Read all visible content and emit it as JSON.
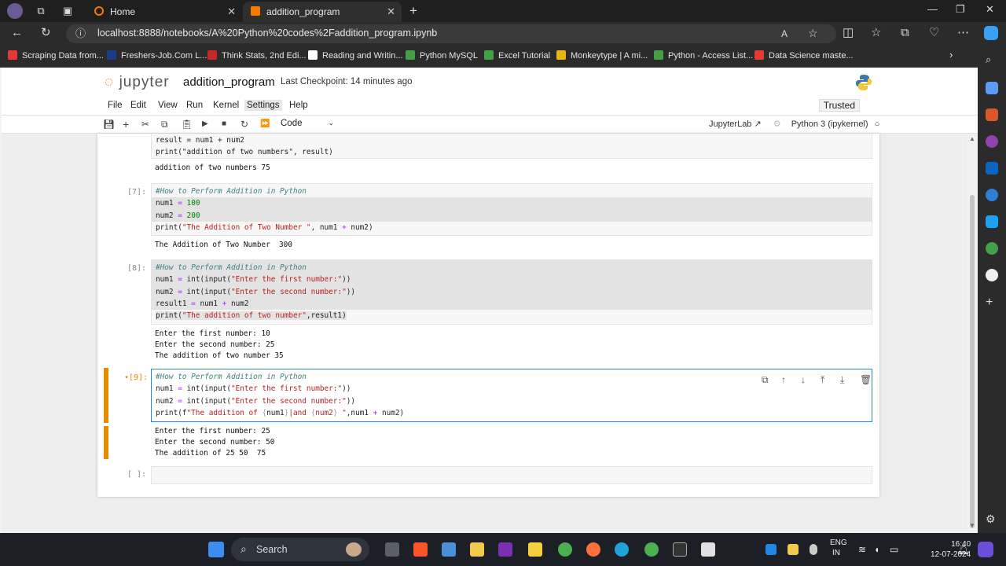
{
  "browser": {
    "tabs": [
      {
        "title": "Home"
      },
      {
        "title": "addition_program"
      }
    ],
    "url": "localhost:8888/notebooks/A%20Python%20codes%2Faddition_program.ipynb",
    "bookmarks": [
      {
        "label": "Scraping Data from...",
        "color": "#e53935"
      },
      {
        "label": "Freshers-Job.Com L...",
        "color": "#1e3a8a"
      },
      {
        "label": "Think Stats, 2nd Edi...",
        "color": "#c62828"
      },
      {
        "label": "Reading and Writin...",
        "color": "#ffffff"
      },
      {
        "label": "Python MySQL",
        "color": "#43a047"
      },
      {
        "label": "Excel Tutorial",
        "color": "#43a047"
      },
      {
        "label": "Monkeytype | A mi...",
        "color": "#e2b714"
      },
      {
        "label": "Python - Access List...",
        "color": "#43a047"
      },
      {
        "label": "Data Science maste...",
        "color": "#e53935"
      }
    ]
  },
  "jupyter": {
    "logo_text": "jupyter",
    "notebook_name": "addition_program",
    "checkpoint": "Last Checkpoint: 14 minutes ago",
    "menu": [
      "File",
      "Edit",
      "View",
      "Run",
      "Kernel",
      "Settings",
      "Help"
    ],
    "trusted": "Trusted",
    "cell_type": "Code",
    "jupyterlab_link": "JupyterLab",
    "kernel": "Python 3 (ipykernel)"
  },
  "cells": {
    "c6": {
      "lines": [
        "result = num1 + num2",
        "print(\"addition of two numbers\", result)"
      ],
      "output": "addition of two numbers 75"
    },
    "c7": {
      "prompt": "[7]:",
      "output": "The Addition of Two Number  300"
    },
    "c8": {
      "prompt": "[8]:",
      "output": [
        "Enter the first number: 10",
        "Enter the second number: 25",
        "The addition of two number 35"
      ]
    },
    "c9": {
      "prompt": "•[9]:",
      "output": [
        "Enter the first number: 25",
        "Enter the second number: 50",
        "The addition of 25 50  75"
      ]
    },
    "empty": {
      "prompt": "[ ]:"
    }
  },
  "taskbar": {
    "search": "Search",
    "lang": [
      "ENG",
      "IN"
    ],
    "time": "16:40",
    "date": "12-07-2024"
  }
}
